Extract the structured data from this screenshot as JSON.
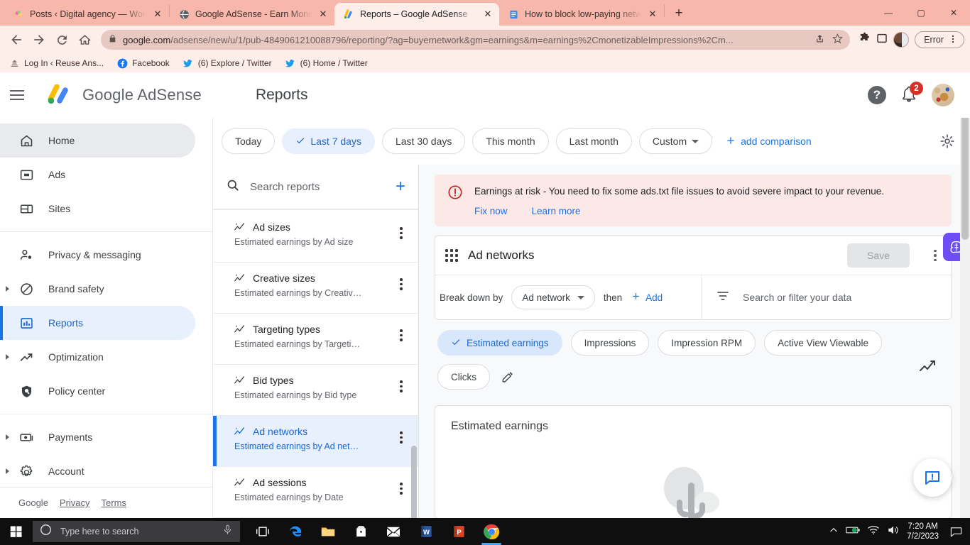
{
  "browser": {
    "tabs": [
      {
        "title": "Posts ‹ Digital agency — WordPre",
        "favicon": "wordpress-icon",
        "active": false
      },
      {
        "title": "Google AdSense - Earn Money Fr",
        "favicon": "adsense-globe-icon",
        "active": false
      },
      {
        "title": "Reports – Google AdSense",
        "favicon": "adsense-icon",
        "active": true
      },
      {
        "title": "How to block low-paying networ",
        "favicon": "docs-icon",
        "active": false
      }
    ],
    "new_tab_label": "+",
    "window_controls": {
      "minimize": "—",
      "maximize": "▢",
      "close": "✕"
    },
    "url_host": "google.com",
    "url_rest": "/adsense/new/u/1/pub-4849061210088796/reporting/?ag=buyernetwork&gm=earnings&m=earnings%2CmonetizableImpressions%2Cm...",
    "error_pill_label": "Error",
    "bookmarks": [
      {
        "label": "Log In ‹ Reuse Ans...",
        "icon": "site-icon"
      },
      {
        "label": "Facebook",
        "icon": "facebook-icon"
      },
      {
        "label": "(6) Explore / Twitter",
        "icon": "twitter-icon"
      },
      {
        "label": "(6) Home / Twitter",
        "icon": "twitter-icon"
      }
    ]
  },
  "appheader": {
    "brand": "Google AdSense",
    "page_title": "Reports",
    "notification_count": "2",
    "help_label": "?"
  },
  "sidebar": {
    "items": [
      {
        "label": "Home",
        "icon": "home-icon",
        "state": "hovered",
        "expandable": false
      },
      {
        "label": "Ads",
        "icon": "ads-icon",
        "state": "normal",
        "expandable": false
      },
      {
        "label": "Sites",
        "icon": "sites-icon",
        "state": "normal",
        "expandable": false
      },
      {
        "label": "Privacy & messaging",
        "icon": "person-check-icon",
        "state": "normal",
        "expandable": false
      },
      {
        "label": "Brand safety",
        "icon": "block-icon",
        "state": "normal",
        "expandable": true
      },
      {
        "label": "Reports",
        "icon": "bar-chart-icon",
        "state": "active",
        "expandable": false
      },
      {
        "label": "Optimization",
        "icon": "trending-up-icon",
        "state": "normal",
        "expandable": true
      },
      {
        "label": "Policy center",
        "icon": "shield-icon",
        "state": "normal",
        "expandable": false
      },
      {
        "label": "Payments",
        "icon": "money-icon",
        "state": "normal",
        "expandable": true
      },
      {
        "label": "Account",
        "icon": "gear-icon",
        "state": "normal",
        "expandable": true
      }
    ],
    "footer": {
      "google": "Google",
      "privacy": "Privacy",
      "terms": "Terms"
    }
  },
  "daterange": {
    "chips": [
      {
        "label": "Today",
        "selected": false,
        "dropdown": false
      },
      {
        "label": "Last 7 days",
        "selected": true,
        "dropdown": false
      },
      {
        "label": "Last 30 days",
        "selected": false,
        "dropdown": false
      },
      {
        "label": "This month",
        "selected": false,
        "dropdown": false
      },
      {
        "label": "Last month",
        "selected": false,
        "dropdown": false
      },
      {
        "label": "Custom",
        "selected": false,
        "dropdown": true
      }
    ],
    "add_comparison": "add comparison"
  },
  "reports_panel": {
    "search_placeholder": "Search reports",
    "add_label": "+",
    "items": [
      {
        "title": "Ad sizes",
        "subtitle": "Estimated earnings by Ad size",
        "active": false
      },
      {
        "title": "Creative sizes",
        "subtitle": "Estimated earnings by Creativ…",
        "active": false
      },
      {
        "title": "Targeting types",
        "subtitle": "Estimated earnings by Targeti…",
        "active": false
      },
      {
        "title": "Bid types",
        "subtitle": "Estimated earnings by Bid type",
        "active": false
      },
      {
        "title": "Ad networks",
        "subtitle": "Estimated earnings by Ad net…",
        "active": true
      },
      {
        "title": "Ad sessions",
        "subtitle": "Estimated earnings by Date",
        "active": false
      }
    ]
  },
  "alert": {
    "message": "Earnings at risk - You need to fix some ads.txt file issues to avoid severe impact to your revenue.",
    "fix_now": "Fix now",
    "learn_more": "Learn more"
  },
  "report": {
    "title": "Ad networks",
    "save_label": "Save",
    "breakdown_label": "Break down by",
    "breakdown_value": "Ad network",
    "then_label": "then",
    "add_label": "Add",
    "filter_placeholder": "Search or filter your data",
    "metrics": [
      {
        "label": "Estimated earnings",
        "selected": true
      },
      {
        "label": "Impressions",
        "selected": false
      },
      {
        "label": "Impression RPM",
        "selected": false
      },
      {
        "label": "Active View Viewable",
        "selected": false
      },
      {
        "label": "Clicks",
        "selected": false
      }
    ],
    "chart_title": "Estimated earnings"
  },
  "chart_data": {
    "type": "line",
    "title": "Estimated earnings",
    "state": "loading",
    "categories": [],
    "values": [],
    "xlabel": "",
    "ylabel": "",
    "legend": []
  },
  "taskbar": {
    "search_placeholder": "Type here to search",
    "apps": [
      {
        "name": "task-view-icon",
        "running": false
      },
      {
        "name": "edge-icon",
        "running": false
      },
      {
        "name": "file-explorer-icon",
        "running": false
      },
      {
        "name": "microsoft-store-icon",
        "running": false
      },
      {
        "name": "mail-icon",
        "running": false
      },
      {
        "name": "word-icon",
        "running": false
      },
      {
        "name": "powerpoint-icon",
        "running": false
      },
      {
        "name": "chrome-icon",
        "running": true
      }
    ],
    "time": "7:20 AM",
    "date": "7/2/2023"
  }
}
